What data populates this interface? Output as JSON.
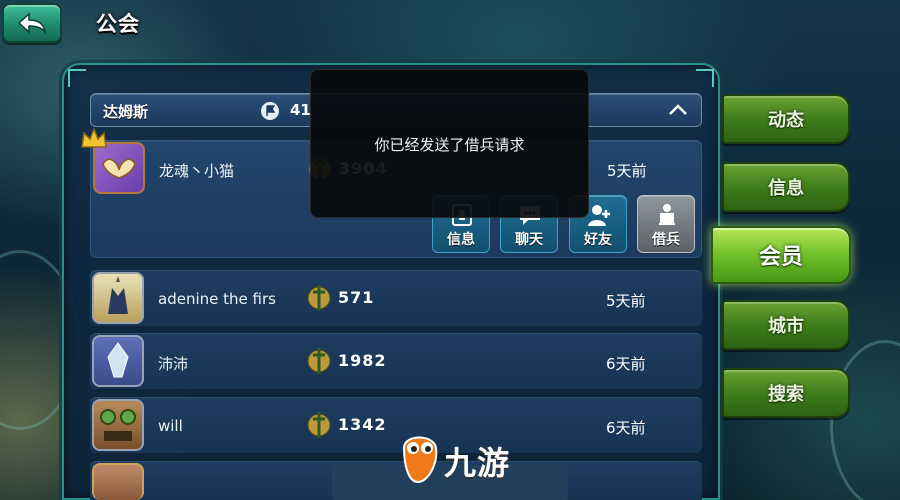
{
  "header": {
    "title": "公会"
  },
  "guild": {
    "name": "达姆斯",
    "member_count": "41"
  },
  "toast": {
    "message": "你已经发送了借兵请求"
  },
  "members": [
    {
      "name": "龙魂丶小猫",
      "score": "3904",
      "last_seen": "5天前",
      "leader": true
    },
    {
      "name": "adenine the firs",
      "score": "571",
      "last_seen": "5天前"
    },
    {
      "name": "沛沛",
      "score": "1982",
      "last_seen": "6天前"
    },
    {
      "name": "will",
      "score": "1342",
      "last_seen": "6天前"
    }
  ],
  "member_actions": {
    "info": "信息",
    "chat": "聊天",
    "friend": "好友",
    "borrow": "借兵"
  },
  "tabs": [
    {
      "label": "动态"
    },
    {
      "label": "信息"
    },
    {
      "label": "会员",
      "active": true
    },
    {
      "label": "城市"
    },
    {
      "label": "搜索"
    }
  ],
  "watermark": {
    "text": "九游"
  },
  "colors": {
    "tab_green": "#3c7a1a",
    "tab_active": "#6fbf2a",
    "row_blue": "#1e3d60",
    "panel_border": "#2c8f88"
  }
}
